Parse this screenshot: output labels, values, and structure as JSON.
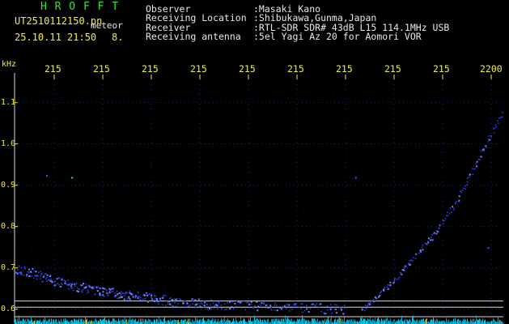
{
  "header": {
    "program": "H R O F F T",
    "filename": "UT2510112150.pn",
    "mode": "meteor",
    "datetime": "25.10.11 21:50",
    "frame_no": "8.",
    "observer_label": "Observer",
    "observer_value": ":Masaki Kano",
    "location_label": "Receiving Location",
    "location_value": ":Shibukawa,Gunma,Japan",
    "receiver_label": "Receiver",
    "receiver_value": ":RTL-SDR SDR# 43dB L15 114.1MHz USB",
    "antenna_label": "Receiving antenna",
    "antenna_value": ":5el Yagi Az 20 for Aomori VOR"
  },
  "axis": {
    "unit": "kHz",
    "y_tick_labels": [
      "1.1",
      "1.0",
      "0.9",
      "0.8",
      "0.7",
      "0.6"
    ],
    "x_tick_labels": [
      "215",
      "215",
      "215",
      "215",
      "215",
      "215",
      "215",
      "215",
      "215",
      "2200"
    ]
  },
  "chart_data": {
    "type": "scatter",
    "title": "",
    "xlabel": "",
    "ylabel": "kHz",
    "ylim": [
      0.58,
      1.16
    ],
    "x_ticks": [
      "215",
      "215",
      "215",
      "215",
      "215",
      "215",
      "215",
      "215",
      "215",
      "2200"
    ],
    "y_ticks": [
      1.1,
      1.0,
      0.9,
      0.8,
      0.7,
      0.6
    ],
    "grid": "dotted",
    "reference_lines_khz": [
      0.62,
      0.605
    ],
    "series": [
      {
        "trace": "decaying",
        "points": [
          [
            0,
            0.7
          ],
          [
            20,
            0.69
          ],
          [
            40,
            0.675
          ],
          [
            60,
            0.665
          ],
          [
            80,
            0.655
          ],
          [
            100,
            0.648
          ],
          [
            120,
            0.642
          ],
          [
            140,
            0.636
          ],
          [
            160,
            0.632
          ],
          [
            180,
            0.626
          ],
          [
            200,
            0.62
          ],
          [
            230,
            0.615
          ],
          [
            260,
            0.612
          ],
          [
            300,
            0.61
          ],
          [
            340,
            0.607
          ],
          [
            380,
            0.604
          ],
          [
            420,
            0.6
          ]
        ]
      },
      {
        "trace": "rising",
        "points": [
          [
            440,
            0.6
          ],
          [
            470,
            0.65
          ],
          [
            500,
            0.71
          ],
          [
            530,
            0.78
          ],
          [
            560,
            0.86
          ],
          [
            590,
            0.97
          ],
          [
            620,
            1.08
          ]
        ]
      }
    ],
    "colors": {
      "signal": "#2f45ff",
      "grid": "#1c2c6a",
      "bottom_band": "#00d8ff",
      "ref_line": "#d8d8d8"
    }
  },
  "colors": {
    "background": "#000000",
    "header_text": "#e8e8e8",
    "axis_labels": "#f2ee3c",
    "program_name": "#2ee83a"
  }
}
